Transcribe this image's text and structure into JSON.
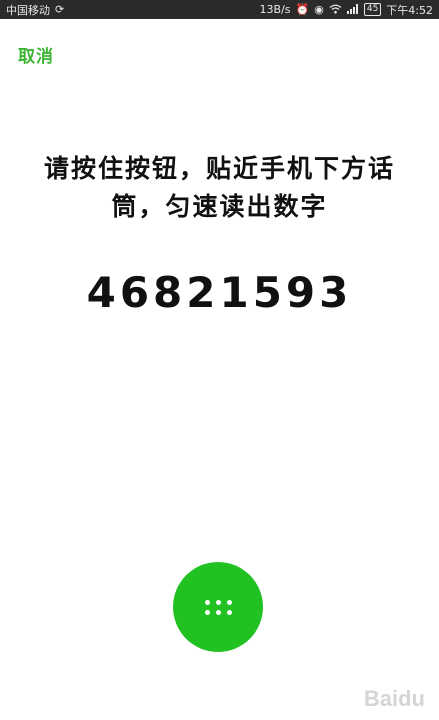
{
  "status_bar": {
    "carrier": "中国移动",
    "net_speed": "13B/s",
    "time": "下午4:52",
    "battery": "45",
    "icons": [
      "alarm-icon",
      "eye-icon",
      "wifi-icon",
      "signal-icon",
      "battery-icon"
    ]
  },
  "header": {
    "cancel_label": "取消"
  },
  "main": {
    "instruction": "请按住按钮，贴近手机下方话筒，匀速读出数字",
    "digits": "46821593"
  },
  "keypad_button": {
    "icon": "dial-pad-icon",
    "color": "#22c122"
  },
  "watermark": {
    "text": "Baidu"
  },
  "colors": {
    "accent": "#3db535",
    "status_bar_bg": "#2b2b2b"
  }
}
